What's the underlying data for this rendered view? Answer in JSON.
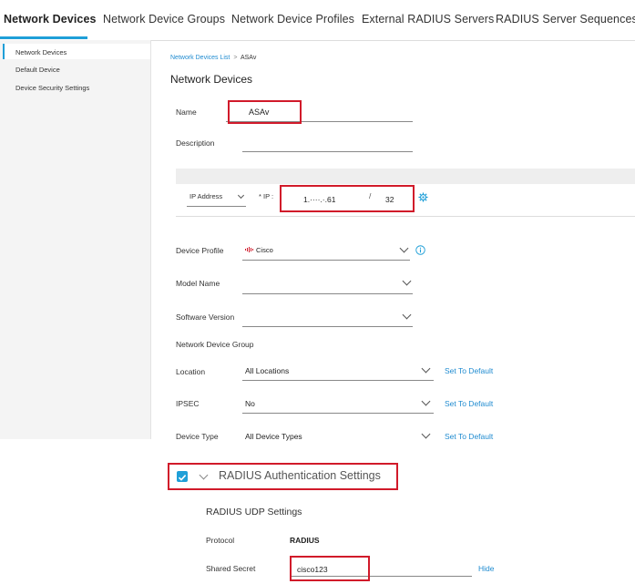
{
  "tabs": [
    "Network Devices",
    "Network Device Groups",
    "Network Device Profiles",
    "External RADIUS Servers",
    "RADIUS Server Sequences"
  ],
  "sidebar": {
    "items": [
      "Network Devices",
      "Default Device",
      "Device Security Settings"
    ]
  },
  "breadcrumb": {
    "parent": "Network Devices List",
    "separator": ">",
    "current": "ASAv"
  },
  "page_title": "Network Devices",
  "form": {
    "name_label": "Name",
    "name_value": "ASAv",
    "description_label": "Description",
    "ip_type": "IP Address",
    "ip_label": "* IP :",
    "ip_value": "1.····.·.61",
    "ip_slash": "/",
    "ip_mask": "32",
    "device_profile_label": "Device Profile",
    "device_profile_value": "Cisco",
    "device_profile_logo": "cisco-logo",
    "model_name_label": "Model Name",
    "software_version_label": "Software Version",
    "ndg_heading": "Network Device Group",
    "location_label": "Location",
    "location_value": "All Locations",
    "ipsec_label": "IPSEC",
    "ipsec_value": "No",
    "device_type_label": "Device Type",
    "device_type_value": "All Device Types",
    "set_default": "Set To Default"
  },
  "radius": {
    "checked": true,
    "title": "RADIUS Authentication Settings",
    "udp_heading": "RADIUS UDP Settings",
    "protocol_label": "Protocol",
    "protocol_value": "RADIUS",
    "secret_label": "Shared Secret",
    "secret_value": "cisco123",
    "hide_label": "Hide"
  },
  "colors": {
    "accent": "#1f9fd8",
    "highlight": "#d11a2a",
    "link": "#1f8bd0"
  }
}
